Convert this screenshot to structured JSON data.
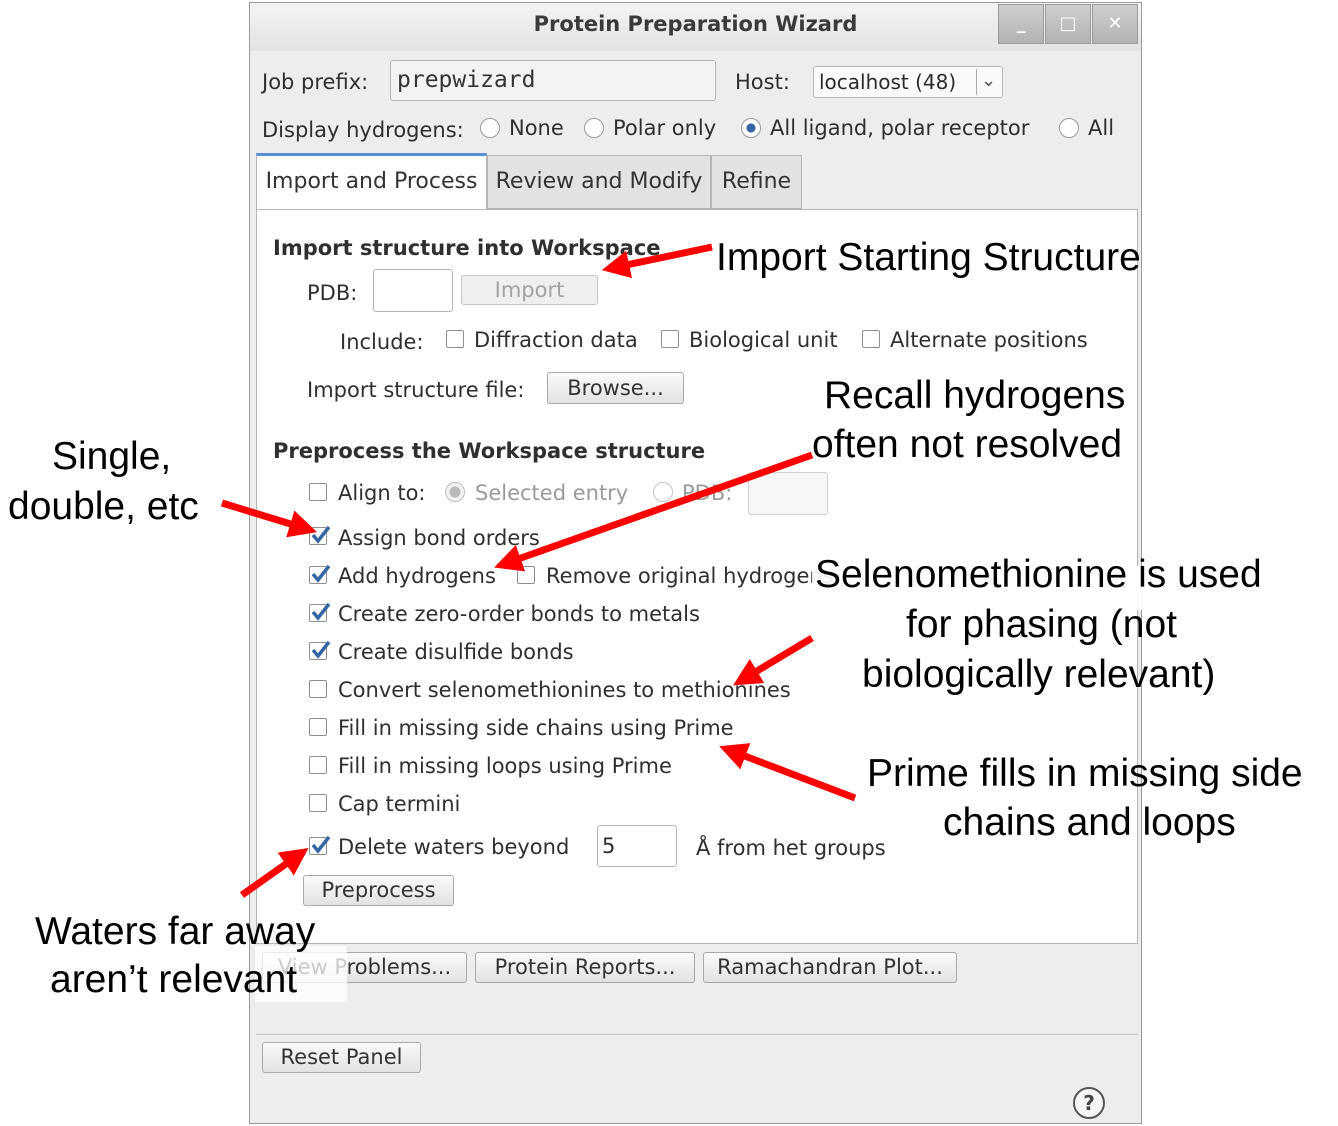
{
  "window": {
    "title": "Protein Preparation Wizard",
    "controls": [
      "_",
      "□",
      "✕"
    ]
  },
  "header": {
    "job_prefix_label": "Job prefix:",
    "job_prefix_value": "prepwizard",
    "host_label": "Host:",
    "host_value": "localhost (48)",
    "display_h_label": "Display hydrogens:",
    "display_h_options": [
      {
        "label": "None",
        "selected": false
      },
      {
        "label": "Polar only",
        "selected": false
      },
      {
        "label": "All ligand, polar receptor",
        "selected": true
      },
      {
        "label": "All",
        "selected": false
      }
    ]
  },
  "tabs": [
    {
      "label": "Import and Process",
      "active": true
    },
    {
      "label": "Review and Modify",
      "active": false
    },
    {
      "label": "Refine",
      "active": false
    }
  ],
  "import_section": {
    "heading": "Import structure into Workspace",
    "pdb_label": "PDB:",
    "pdb_value": "",
    "import_button": "Import",
    "include_label": "Include:",
    "include_options": [
      {
        "label": "Diffraction data",
        "checked": false
      },
      {
        "label": "Biological unit",
        "checked": false
      },
      {
        "label": "Alternate positions",
        "checked": false
      }
    ],
    "file_label": "Import structure file:",
    "browse_button": "Browse..."
  },
  "preprocess_section": {
    "heading": "Preprocess the Workspace structure",
    "align_label": "Align to:",
    "align_checked": false,
    "selected_entry_label": "Selected entry",
    "pdb_option_label": "PDB:",
    "assign_bond_orders": {
      "label": "Assign bond orders",
      "checked": true
    },
    "add_hydrogens": {
      "label": "Add hydrogens",
      "checked": true
    },
    "remove_original_h": {
      "label": "Remove original hydrogens",
      "checked": false
    },
    "zero_order_bonds": {
      "label": "Create zero-order bonds to metals",
      "checked": true
    },
    "disulfide_bonds": {
      "label": "Create disulfide bonds",
      "checked": true
    },
    "convert_selenomet": {
      "label": "Convert selenomethionines to methionines",
      "checked": false
    },
    "fill_side_chains": {
      "label": "Fill in missing side chains using Prime",
      "checked": false
    },
    "fill_loops": {
      "label": "Fill in missing loops using Prime",
      "checked": false
    },
    "cap_termini": {
      "label": "Cap termini",
      "checked": false
    },
    "delete_waters": {
      "label": "Delete waters beyond",
      "checked": true,
      "value": "5",
      "suffix": "Å from het groups"
    },
    "preprocess_button": "Preprocess"
  },
  "bottom_buttons": {
    "view_problems": "View Problems...",
    "protein_reports": "Protein Reports...",
    "ramachandran": "Ramachandran Plot...",
    "reset_panel": "Reset Panel",
    "help": "?"
  },
  "annotations": {
    "import_starting": "Import Starting Structure",
    "recall_h_1": "Recall hydrogens",
    "recall_h_2": "often not resolved",
    "single_1": "Single,",
    "single_2": "double, etc",
    "selenomet_1": "Selenomethionine is used",
    "selenomet_2": "for phasing (not",
    "selenomet_3": "biologically relevant)",
    "prime_1": "Prime fills in missing side",
    "prime_2": "chains and loops",
    "waters_1": "Waters far away",
    "waters_2": "aren’t relevant"
  },
  "colors": {
    "arrow": "#ff0000",
    "check": "#3465a4",
    "active_tab_accent": "#5b8fd6"
  }
}
